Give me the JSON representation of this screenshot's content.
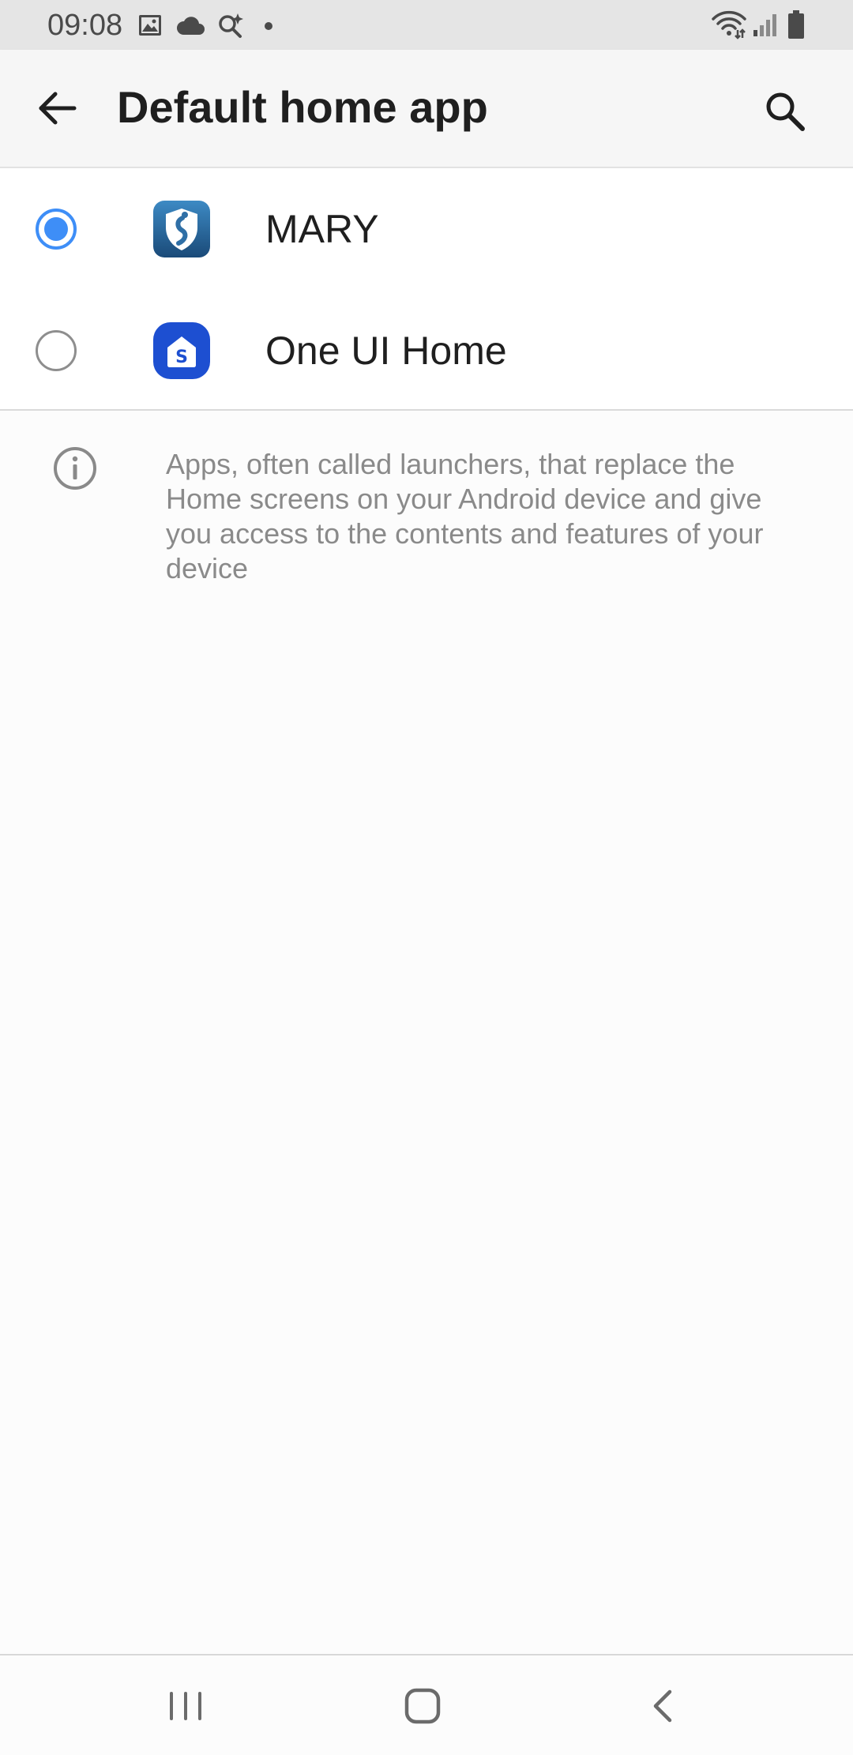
{
  "status_bar": {
    "time": "09:08",
    "left_icons": [
      "gallery-icon",
      "cloud-icon",
      "sparkle-search-icon",
      "dot-icon"
    ],
    "right_icons": [
      "wifi-icon",
      "signal-icon",
      "battery-icon"
    ]
  },
  "app_bar": {
    "title": "Default home app",
    "back_icon": "arrow-left-icon",
    "search_icon": "search-icon"
  },
  "apps": [
    {
      "label": "MARY",
      "selected": true,
      "icon": "mary-shield-icon"
    },
    {
      "label": "One UI Home",
      "selected": false,
      "icon": "one-ui-home-icon"
    }
  ],
  "info": {
    "icon": "info-icon",
    "text": "Apps, often called launchers, that replace the Home screens on your Android device and give you access to the contents and features of your device"
  },
  "nav_bar": {
    "icons": [
      "recents-icon",
      "home-icon",
      "back-icon"
    ]
  },
  "colors": {
    "accent": "#3e8ef7",
    "status_bar_bg": "#e5e5e5",
    "app_bar_bg": "#f6f6f6",
    "page_bg": "#fcfcfc",
    "secondary_text": "#8a8a8a",
    "one_ui_blue": "#1d4fd1"
  }
}
